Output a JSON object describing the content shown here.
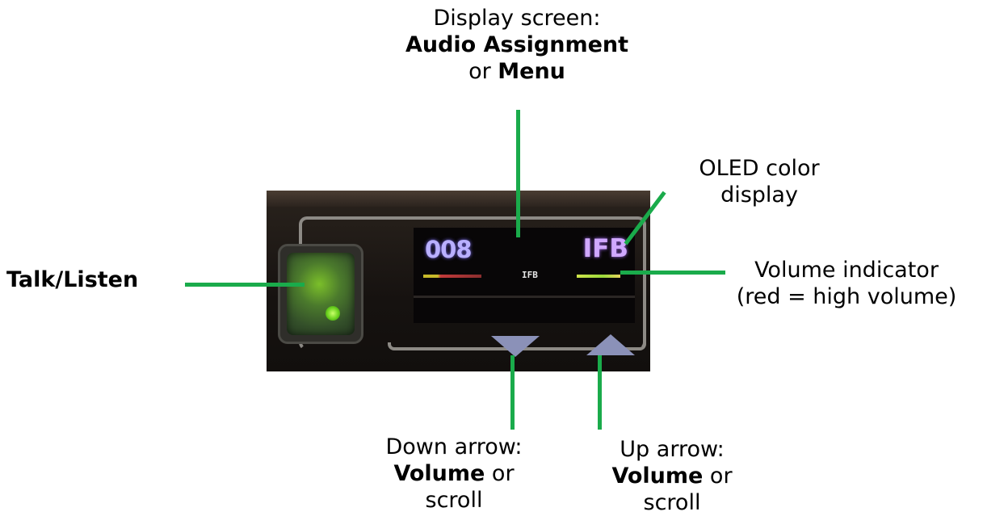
{
  "labels": {
    "display_screen_line1": "Display screen:",
    "display_screen_line2": "Audio Assignment",
    "display_screen_line3_prefix": "or ",
    "display_screen_line3_bold": "Menu",
    "oled_line1": "OLED color",
    "oled_line2": "display",
    "talk_listen": "Talk/Listen",
    "volume_indicator_line1": "Volume indicator",
    "volume_indicator_line2": "(red = high volume)",
    "down_arrow_line1": "Down arrow:",
    "down_arrow_bold": "Volume",
    "down_arrow_or": " or",
    "down_arrow_line3": "scroll",
    "up_arrow_line1": "Up arrow:",
    "up_arrow_bold": "Volume",
    "up_arrow_or": " or",
    "up_arrow_line3": "scroll"
  },
  "device": {
    "channel_number": "008",
    "channel_name": "IFB",
    "small_label": "IFB"
  },
  "colors": {
    "leader_line": "#1aab4b",
    "oled_number": "#b9b0ff",
    "oled_name": "#d0a8ff",
    "talk_button_glow": "#7bbf2a"
  }
}
